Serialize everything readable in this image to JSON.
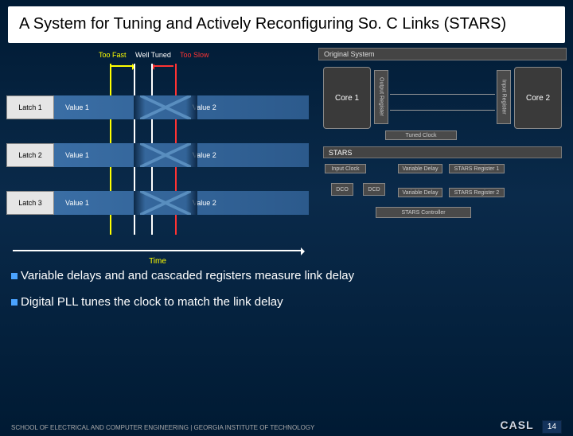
{
  "title": "A System for Tuning and Actively Reconfiguring So. C Links (STARS)",
  "timing": {
    "too_fast": "Too Fast",
    "well_tuned": "Well Tuned",
    "too_slow": "Too Slow"
  },
  "latches": [
    {
      "name": "Latch 1",
      "v1": "Value 1",
      "v2": "Value 2"
    },
    {
      "name": "Latch 2",
      "v1": "Value 1",
      "v2": "Value 2"
    },
    {
      "name": "Latch 3",
      "v1": "Value 1",
      "v2": "Value 2"
    }
  ],
  "time_axis_label": "Time",
  "diagram": {
    "original_system": "Original System",
    "core1": "Core 1",
    "core2": "Core 2",
    "output_register": "Output Register",
    "input_register": "Input Register",
    "tuned_clock": "Tuned Clock",
    "stars": "STARS",
    "input_clock": "Input Clock",
    "dco": "DCO",
    "dcd": "DCD",
    "variable_delay": "Variable Delay",
    "stars_reg1": "STARS Register 1",
    "stars_reg2": "STARS Register 2",
    "stars_controller": "STARS Controller"
  },
  "bullets": {
    "b1": "Variable delays and and cascaded registers  measure link delay",
    "b2": "Digital PLL tunes the clock to match the link delay"
  },
  "footer": {
    "school": "SCHOOL OF ELECTRICAL AND COMPUTER ENGINEERING | GEORGIA INSTITUTE OF TECHNOLOGY",
    "lab": "CASL",
    "page": "14"
  }
}
